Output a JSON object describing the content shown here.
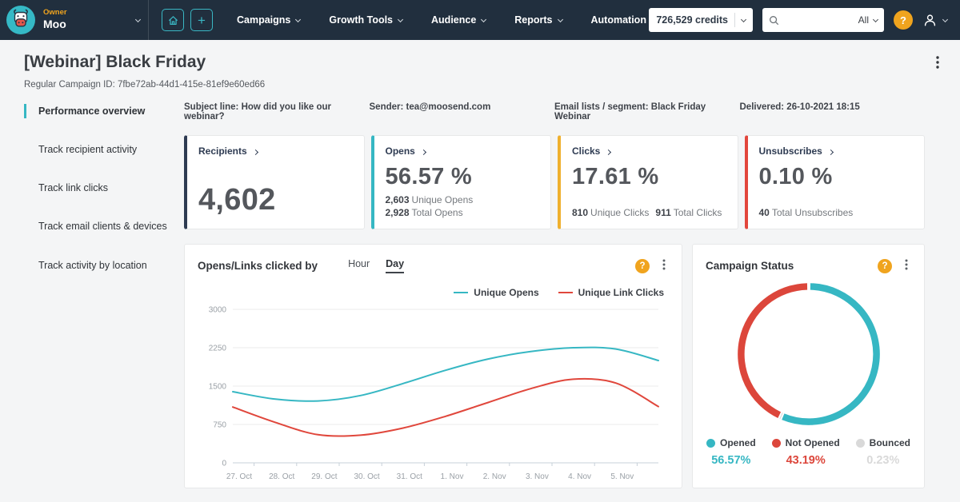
{
  "navbar": {
    "owner_label": "Owner",
    "account_name": "Moo",
    "menu_items": [
      "Campaigns",
      "Growth Tools",
      "Audience",
      "Reports",
      "Automation"
    ],
    "credits_label": "726,529 credits",
    "search_filter": "All",
    "help_label": "?"
  },
  "page": {
    "title": "[Webinar] Black Friday",
    "subtitle": "Regular Campaign ID: 7fbe72ab-44d1-415e-81ef9e60ed66"
  },
  "sidebar": {
    "items": [
      {
        "label": "Performance overview",
        "active": true
      },
      {
        "label": "Track recipient activity",
        "active": false
      },
      {
        "label": "Track link clicks",
        "active": false
      },
      {
        "label": "Track email clients & devices",
        "active": false
      },
      {
        "label": "Track activity by location",
        "active": false
      }
    ]
  },
  "meta": {
    "subject": "Subject line: How did you like our webinar?",
    "sender": "Sender: tea@moosend.com",
    "lists": "Email lists / segment: Black Friday Webinar",
    "delivered": "Delivered: 26-10-2021 18:15"
  },
  "stat_cards": [
    {
      "label": "Recipients",
      "accent": "#2e3b52",
      "big": "4,602"
    },
    {
      "label": "Opens",
      "accent": "#36b7c3",
      "big": "56.57 %",
      "sub1_value": "2,603",
      "sub1_text": "Unique Opens",
      "sub2_value": "2,928",
      "sub2_text": "Total Opens"
    },
    {
      "label": "Clicks",
      "accent": "#efb02e",
      "big": "17.61 %",
      "sub1_value": "810",
      "sub1_text": "Unique Clicks",
      "sub2_value": "911",
      "sub2_text": "Total Clicks"
    },
    {
      "label": "Unsubscribes",
      "accent": "#e2463c",
      "big": "0.10 %",
      "sub1_value": "40",
      "sub1_text": "Total Unsubscribes"
    }
  ],
  "chart_data": [
    {
      "type": "line",
      "title": "Opens/Links clicked by",
      "tabs": [
        "Hour",
        "Day"
      ],
      "active_tab": "Day",
      "categories": [
        "27. Oct",
        "28. Oct",
        "29. Oct",
        "30. Oct",
        "31. Oct",
        "1. Nov",
        "2. Nov",
        "3. Nov",
        "4. Nov",
        "5. Nov"
      ],
      "series": [
        {
          "name": "Unique Opens",
          "color": "#36b7c3",
          "values": [
            1390,
            1245,
            1210,
            1315,
            1550,
            1810,
            2030,
            2175,
            2250,
            2225,
            2000
          ]
        },
        {
          "name": "Unique Link Clicks",
          "color": "#e0473c",
          "values": [
            1090,
            790,
            550,
            540,
            680,
            910,
            1180,
            1450,
            1635,
            1560,
            1100
          ]
        }
      ],
      "ylim": [
        0,
        3000
      ],
      "yticks": [
        0,
        750,
        1500,
        2250,
        3000
      ],
      "grid": true,
      "legend_position": "top-right",
      "note": "series include one extra unlabeled point extending past the last category"
    },
    {
      "type": "pie",
      "donut": true,
      "title": "Campaign Status",
      "labels": [
        "Opened",
        "Not Opened",
        "Bounced"
      ],
      "values": [
        56.57,
        43.19,
        0.23
      ],
      "display_values": [
        "56.57%",
        "43.19%",
        "0.23%"
      ],
      "colors": [
        "#36b7c3",
        "#dc463b",
        "#d9d9d9"
      ],
      "ring_order": [
        0,
        2,
        1
      ],
      "legend_position": "bottom"
    }
  ]
}
